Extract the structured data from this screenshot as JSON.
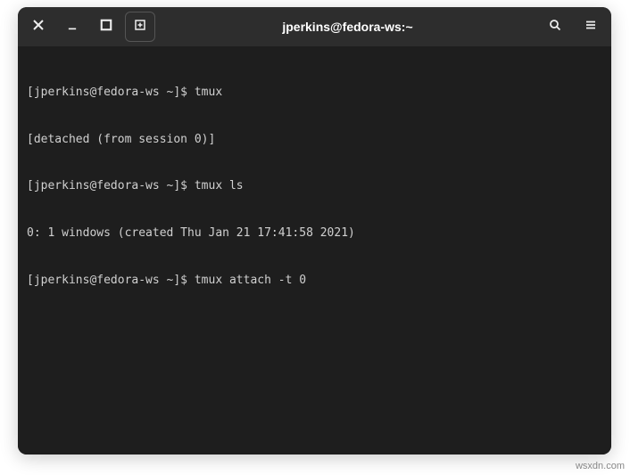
{
  "titlebar": {
    "title": "jperkins@fedora-ws:~"
  },
  "terminal": {
    "lines": {
      "l0_prompt": "[jperkins@fedora-ws ~]$ ",
      "l0_cmd": "tmux",
      "l1": "[detached (from session 0)]",
      "l2_prompt": "[jperkins@fedora-ws ~]$ ",
      "l2_cmd": "tmux ls",
      "l3": "0: 1 windows (created Thu Jan 21 17:41:58 2021)",
      "l4_prompt": "[jperkins@fedora-ws ~]$ ",
      "l4_cmd": "tmux attach -t 0"
    }
  },
  "watermark": "wsxdn.com"
}
